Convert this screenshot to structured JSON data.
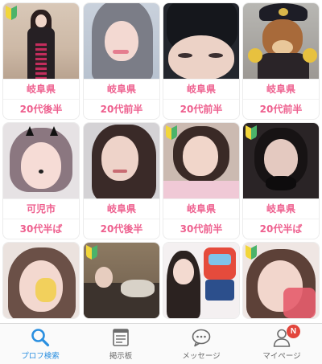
{
  "profiles": [
    {
      "region": "岐阜県",
      "age": "20代後半",
      "beginner": true
    },
    {
      "region": "岐阜県",
      "age": "20代前半",
      "beginner": false
    },
    {
      "region": "岐阜県",
      "age": "20代前半",
      "beginner": false
    },
    {
      "region": "岐阜県",
      "age": "20代前半",
      "beginner": false
    },
    {
      "region": "可児市",
      "age": "30代半ば",
      "beginner": false
    },
    {
      "region": "岐阜県",
      "age": "20代後半",
      "beginner": false
    },
    {
      "region": "岐阜県",
      "age": "30代前半",
      "beginner": true
    },
    {
      "region": "岐阜県",
      "age": "20代半ば",
      "beginner": true
    },
    {
      "region": "",
      "age": "",
      "beginner": false
    },
    {
      "region": "",
      "age": "",
      "beginner": true
    },
    {
      "region": "",
      "age": "",
      "beginner": false
    },
    {
      "region": "",
      "age": "",
      "beginner": true
    }
  ],
  "tabbar": {
    "tabs": [
      {
        "label": "プロフ検索",
        "icon": "search-icon",
        "active": true
      },
      {
        "label": "掲示板",
        "icon": "bulletin-board-icon",
        "active": false
      },
      {
        "label": "メッセージ",
        "icon": "speech-bubble-icon",
        "active": false
      },
      {
        "label": "マイページ",
        "icon": "person-icon",
        "active": false
      }
    ],
    "mypage_badge": "N"
  },
  "colors": {
    "accent_pink": "#ee5f8e",
    "active_blue": "#2a8fe0",
    "badge_red": "#e2453c"
  }
}
